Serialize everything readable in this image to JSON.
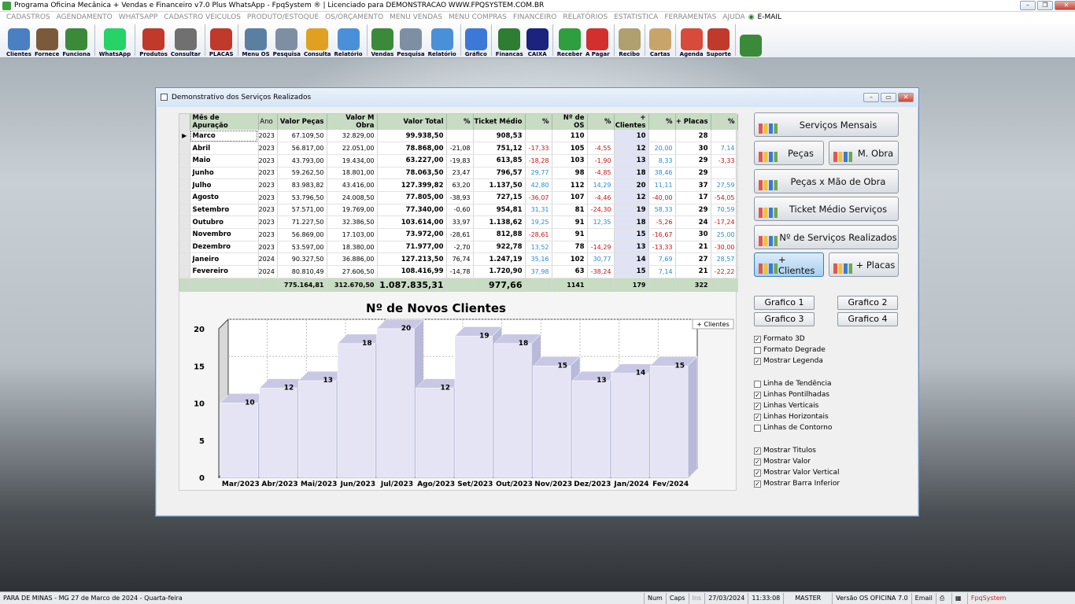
{
  "app": {
    "title": "Programa Oficina Mecânica + Vendas e Financeiro v7.0 Plus WhatsApp - FpqSystem ® | Licenciado para  DEMONSTRACAO WWW.FPQSYSTEM.COM.BR"
  },
  "menu": [
    "CADASTROS",
    "AGENDAMENTO",
    "WHATSAPP",
    "CADASTRO VEICULOS",
    "PRODUTO/ESTOQUE",
    "OS/ORÇAMENTO",
    "MENU VENDAS",
    "MENU COMPRAS",
    "FINANCEIRO",
    "RELATÓRIOS",
    "ESTATISTICA",
    "FERRAMENTAS",
    "AJUDA",
    "E-MAIL"
  ],
  "toolbar": [
    {
      "label": "Clientes",
      "icon": "clients-icon",
      "color": "#4a7fc1"
    },
    {
      "label": "Fornece",
      "icon": "supplier-icon",
      "color": "#7a5a3a"
    },
    {
      "label": "Funciona",
      "icon": "employee-icon",
      "color": "#3a8a3a"
    },
    {
      "label": "WhatsApp",
      "icon": "whatsapp-icon",
      "color": "#25d366"
    },
    {
      "label": "Produtos",
      "icon": "products-icon",
      "color": "#c0392b"
    },
    {
      "label": "Consultar",
      "icon": "consult-icon",
      "color": "#707070"
    },
    {
      "label": "PLACAS",
      "icon": "car-icon",
      "color": "#c0392b"
    },
    {
      "label": "Menu OS",
      "icon": "os-icon",
      "color": "#5b7fa3"
    },
    {
      "label": "Pesquisa",
      "icon": "search-icon",
      "color": "#7f8fa3"
    },
    {
      "label": "Consulta",
      "icon": "folder-icon",
      "color": "#e0a020"
    },
    {
      "label": "Relatório",
      "icon": "report-icon",
      "color": "#4a90d9"
    },
    {
      "label": "Vendas",
      "icon": "cart-icon",
      "color": "#3a8a3a"
    },
    {
      "label": "Pesquisa",
      "icon": "search-icon",
      "color": "#7f8fa3"
    },
    {
      "label": "Relatório",
      "icon": "report-icon",
      "color": "#4a90d9"
    },
    {
      "label": "Gráfico",
      "icon": "chart-icon",
      "color": "#3c78d8"
    },
    {
      "label": "Financas",
      "icon": "finance-icon",
      "color": "#2e7d32"
    },
    {
      "label": "CAIXA",
      "icon": "cashbox-icon",
      "color": "#1a237e"
    },
    {
      "label": "Receber",
      "icon": "dollar-green-icon",
      "color": "#2e9e3e"
    },
    {
      "label": "A Pagar",
      "icon": "dollar-red-icon",
      "color": "#d32f2f"
    },
    {
      "label": "Recibo",
      "icon": "receipt-icon",
      "color": "#b0a070"
    },
    {
      "label": "Cartas",
      "icon": "letter-icon",
      "color": "#c9a46a"
    },
    {
      "label": "Agenda",
      "icon": "calendar-icon",
      "color": "#d84a3a"
    },
    {
      "label": "Suporte",
      "icon": "support-icon",
      "color": "#c0392b"
    },
    {
      "label": "",
      "icon": "exit-icon",
      "color": "#3a8a3a"
    }
  ],
  "window": {
    "title": "Demonstrativo dos Serviços Realizados"
  },
  "table": {
    "headers": [
      "Mês de Apuração",
      "Ano",
      "Valor Peças",
      "Valor M Obra",
      "Valor Total",
      "%",
      "Ticket Médio",
      "%",
      "Nº de OS",
      "%",
      "+ Clientes",
      "%",
      "+ Placas",
      "%"
    ],
    "rows": [
      [
        "Marco",
        "2023",
        "67.109,50",
        "32.829,00",
        "99.938,50",
        "",
        "908,53",
        "",
        "110",
        "",
        "10",
        "",
        "28",
        ""
      ],
      [
        "Abril",
        "2023",
        "56.817,00",
        "22.051,00",
        "78.868,00",
        "-21,08",
        "751,12",
        "-17,33",
        "105",
        "-4,55",
        "12",
        "20,00",
        "30",
        "7,14"
      ],
      [
        "Maio",
        "2023",
        "43.793,00",
        "19.434,00",
        "63.227,00",
        "-19,83",
        "613,85",
        "-18,28",
        "103",
        "-1,90",
        "13",
        "8,33",
        "29",
        "-3,33"
      ],
      [
        "Junho",
        "2023",
        "59.262,50",
        "18.801,00",
        "78.063,50",
        "23,47",
        "796,57",
        "29,77",
        "98",
        "-4,85",
        "18",
        "38,46",
        "29",
        ""
      ],
      [
        "Julho",
        "2023",
        "83.983,82",
        "43.416,00",
        "127.399,82",
        "63,20",
        "1.137,50",
        "42,80",
        "112",
        "14,29",
        "20",
        "11,11",
        "37",
        "27,59"
      ],
      [
        "Agosto",
        "2023",
        "53.796,50",
        "24.008,50",
        "77.805,00",
        "-38,93",
        "727,15",
        "-36,07",
        "107",
        "-4,46",
        "12",
        "-40,00",
        "17",
        "-54,05"
      ],
      [
        "Setembro",
        "2023",
        "57.571,00",
        "19.769,00",
        "77.340,00",
        "-0,60",
        "954,81",
        "31,31",
        "81",
        "-24,30",
        "19",
        "58,33",
        "29",
        "70,59"
      ],
      [
        "Outubro",
        "2023",
        "71.227,50",
        "32.386,50",
        "103.614,00",
        "33,97",
        "1.138,62",
        "19,25",
        "91",
        "12,35",
        "18",
        "-5,26",
        "24",
        "-17,24"
      ],
      [
        "Novembro",
        "2023",
        "56.869,00",
        "17.103,00",
        "73.972,00",
        "-28,61",
        "812,88",
        "-28,61",
        "91",
        "",
        "15",
        "-16,67",
        "30",
        "25,00"
      ],
      [
        "Dezembro",
        "2023",
        "53.597,00",
        "18.380,00",
        "71.977,00",
        "-2,70",
        "922,78",
        "13,52",
        "78",
        "-14,29",
        "13",
        "-13,33",
        "21",
        "-30,00"
      ],
      [
        "Janeiro",
        "2024",
        "90.327,50",
        "36.886,00",
        "127.213,50",
        "76,74",
        "1.247,19",
        "35,16",
        "102",
        "30,77",
        "14",
        "7,69",
        "27",
        "28,57"
      ],
      [
        "Fevereiro",
        "2024",
        "80.810,49",
        "27.606,50",
        "108.416,99",
        "-14,78",
        "1.720,90",
        "37,98",
        "63",
        "-38,24",
        "15",
        "7,14",
        "21",
        "-22,22"
      ]
    ],
    "totals": [
      "",
      "",
      "775.164,81",
      "312.670,50",
      "1.087.835,31",
      "",
      "977,66",
      "",
      "1141",
      "",
      "179",
      "",
      "322",
      ""
    ]
  },
  "chart_data": {
    "type": "bar",
    "title": "Nº de Novos Clientes",
    "categories": [
      "Mar/2023",
      "Abr/2023",
      "Mai/2023",
      "Jun/2023",
      "Jul/2023",
      "Ago/2023",
      "Set/2023",
      "Out/2023",
      "Nov/2023",
      "Dez/2023",
      "Jan/2024",
      "Fev/2024"
    ],
    "series": [
      {
        "name": "+ Clientes",
        "values": [
          10,
          12,
          13,
          18,
          20,
          12,
          19,
          18,
          15,
          13,
          14,
          15
        ]
      }
    ],
    "yticks": [
      "0",
      "5",
      "10",
      "15",
      "20"
    ],
    "ylim": [
      0,
      20
    ],
    "grid": true,
    "legend": "top-right",
    "bar_color": "#e4e4f4"
  },
  "buttons": {
    "servicos_mensais": "Serviços Mensais",
    "pecas": "Peças",
    "mobra": "M. Obra",
    "pecas_mobra": "Peças x Mão de Obra",
    "ticket": "Ticket Médio Serviços",
    "nservicos": "Nº de Serviços Realizados",
    "clientes": "+ Clientes",
    "placas": "+ Placas",
    "g1": "Grafico 1",
    "g2": "Grafico 2",
    "g3": "Grafico 3",
    "g4": "Grafico 4"
  },
  "options": [
    {
      "label": "Formato 3D",
      "checked": true
    },
    {
      "label": "Formato Degrade",
      "checked": false
    },
    {
      "label": "Mostrar Legenda",
      "checked": true
    },
    {
      "label": "Linha de Tendência",
      "checked": false
    },
    {
      "label": "Linhas Pontilhadas",
      "checked": true
    },
    {
      "label": "Linhas Verticais",
      "checked": true
    },
    {
      "label": "Linhas Horizontais",
      "checked": true
    },
    {
      "label": "Linhas de Contorno",
      "checked": false
    },
    {
      "label": "Mostrar Titulos",
      "checked": true
    },
    {
      "label": "Mostrar Valor",
      "checked": true
    },
    {
      "label": "Mostrar Valor Vertical",
      "checked": true
    },
    {
      "label": "Mostrar Barra Inferior",
      "checked": true
    }
  ],
  "status": {
    "left": "PARA DE MINAS - MG 27 de Marco de 2024 - Quarta-feira",
    "num": "Num",
    "caps": "Caps",
    "ins": "Ins",
    "date": "27/03/2024",
    "time": "11:33:08",
    "user": "MASTER",
    "version": "Versão OS OFICINA 7.0",
    "email": "Email",
    "brand": "FpqSystem"
  }
}
